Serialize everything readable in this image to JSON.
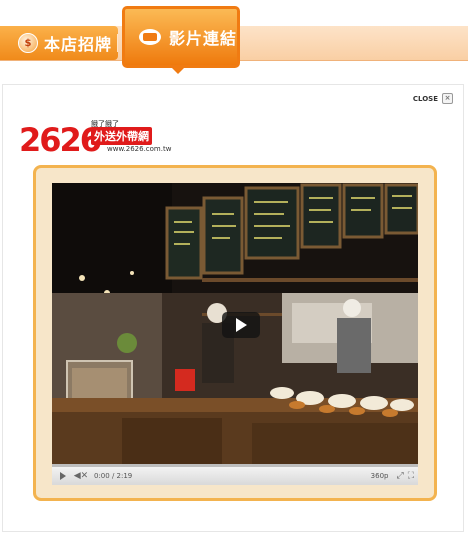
{
  "tabs": {
    "store_label": "本店招牌",
    "video_label": "影片連結"
  },
  "panel": {
    "close_label": "CLOSE",
    "close_glyph": "×"
  },
  "logo": {
    "number": "2626",
    "tagline": "餓了餓了",
    "name": "外送外帶網",
    "url": "www.2626.com.tw"
  },
  "player": {
    "time": "0:00 / 2:19",
    "quality": "360p",
    "progress_fraction": 0.0,
    "icons": [
      "play-icon",
      "volume-muted-icon",
      "expand-icon",
      "fullscreen-icon"
    ]
  },
  "colors": {
    "accent_orange": "#f07b12",
    "frame_border": "#f3b34f",
    "logo_red": "#e01b1b"
  }
}
